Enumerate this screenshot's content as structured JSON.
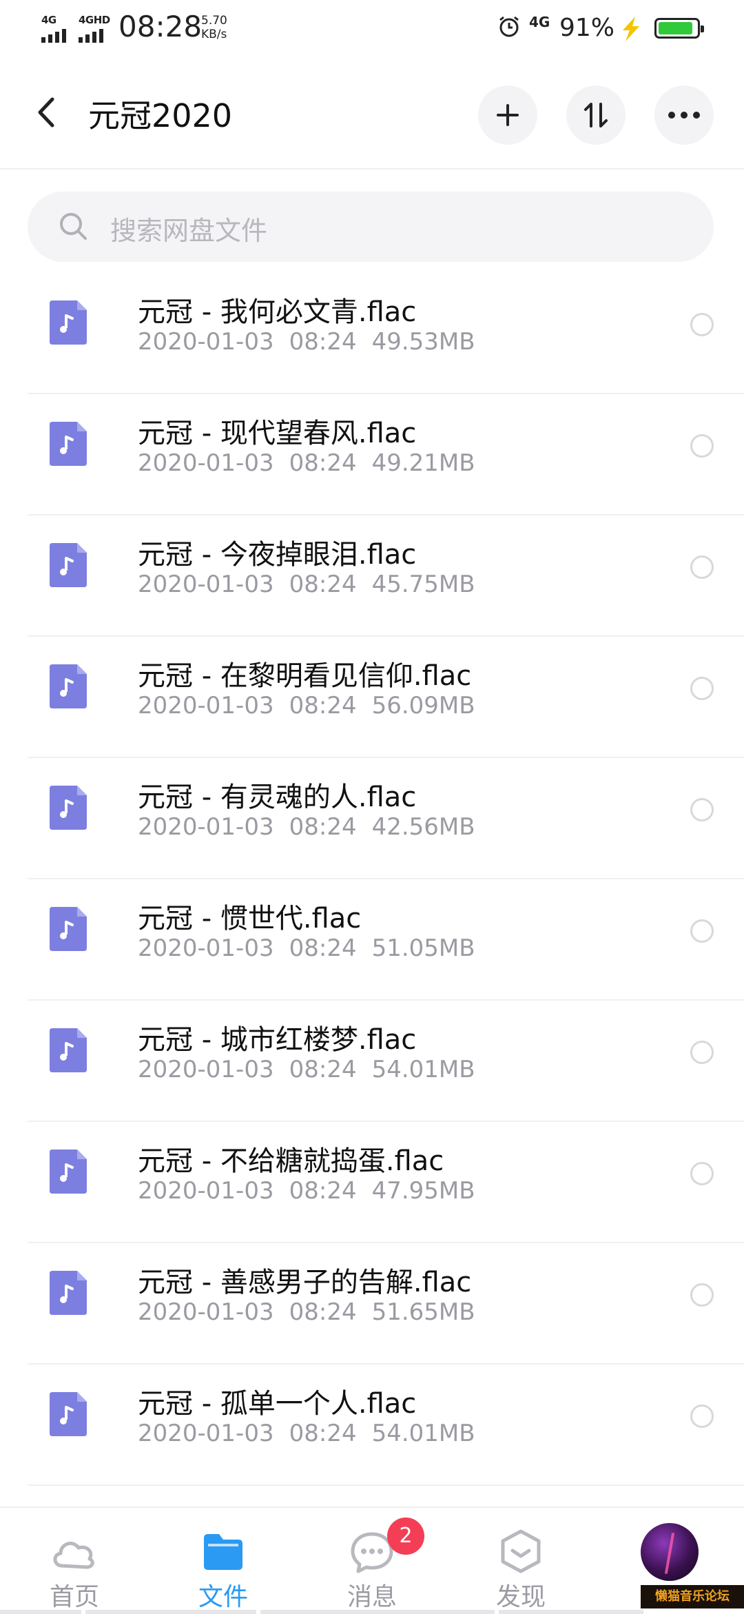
{
  "status_bar": {
    "signal1": "4G",
    "signal2": "4GHD",
    "time": "08:28",
    "speed_value": "5.70",
    "speed_unit": "KB/s",
    "network": "4G",
    "battery_percent": "91%",
    "battery_level": 0.91
  },
  "header": {
    "title": "元冠2020",
    "add_icon": "plus-icon",
    "sort_icon": "sort-icon",
    "more_icon": "more-icon"
  },
  "search": {
    "placeholder": "搜索网盘文件"
  },
  "files": [
    {
      "name": "元冠 - 我何必文青.flac",
      "date": "2020-01-03",
      "time": "08:24",
      "size": "49.53MB"
    },
    {
      "name": "元冠 - 现代望春风.flac",
      "date": "2020-01-03",
      "time": "08:24",
      "size": "49.21MB"
    },
    {
      "name": "元冠 - 今夜掉眼泪.flac",
      "date": "2020-01-03",
      "time": "08:24",
      "size": "45.75MB"
    },
    {
      "name": "元冠 - 在黎明看见信仰.flac",
      "date": "2020-01-03",
      "time": "08:24",
      "size": "56.09MB"
    },
    {
      "name": "元冠 - 有灵魂的人.flac",
      "date": "2020-01-03",
      "time": "08:24",
      "size": "42.56MB"
    },
    {
      "name": "元冠 - 惯世代.flac",
      "date": "2020-01-03",
      "time": "08:24",
      "size": "51.05MB"
    },
    {
      "name": "元冠 - 城市红楼梦.flac",
      "date": "2020-01-03",
      "time": "08:24",
      "size": "54.01MB"
    },
    {
      "name": "元冠 - 不给糖就捣蛋.flac",
      "date": "2020-01-03",
      "time": "08:24",
      "size": "47.95MB"
    },
    {
      "name": "元冠 - 善感男子的告解.flac",
      "date": "2020-01-03",
      "time": "08:24",
      "size": "51.65MB"
    },
    {
      "name": "元冠 - 孤单一个人.flac",
      "date": "2020-01-03",
      "time": "08:24",
      "size": "54.01MB"
    }
  ],
  "nav": {
    "home": "首页",
    "files": "文件",
    "messages": "消息",
    "messages_badge": "2",
    "discover": "发现"
  },
  "watermark": "懒猫音乐论坛",
  "colors": {
    "accent": "#2a9af3",
    "file_icon": "#7c7fe0",
    "badge": "#f43e56",
    "battery": "#2fc93a"
  }
}
